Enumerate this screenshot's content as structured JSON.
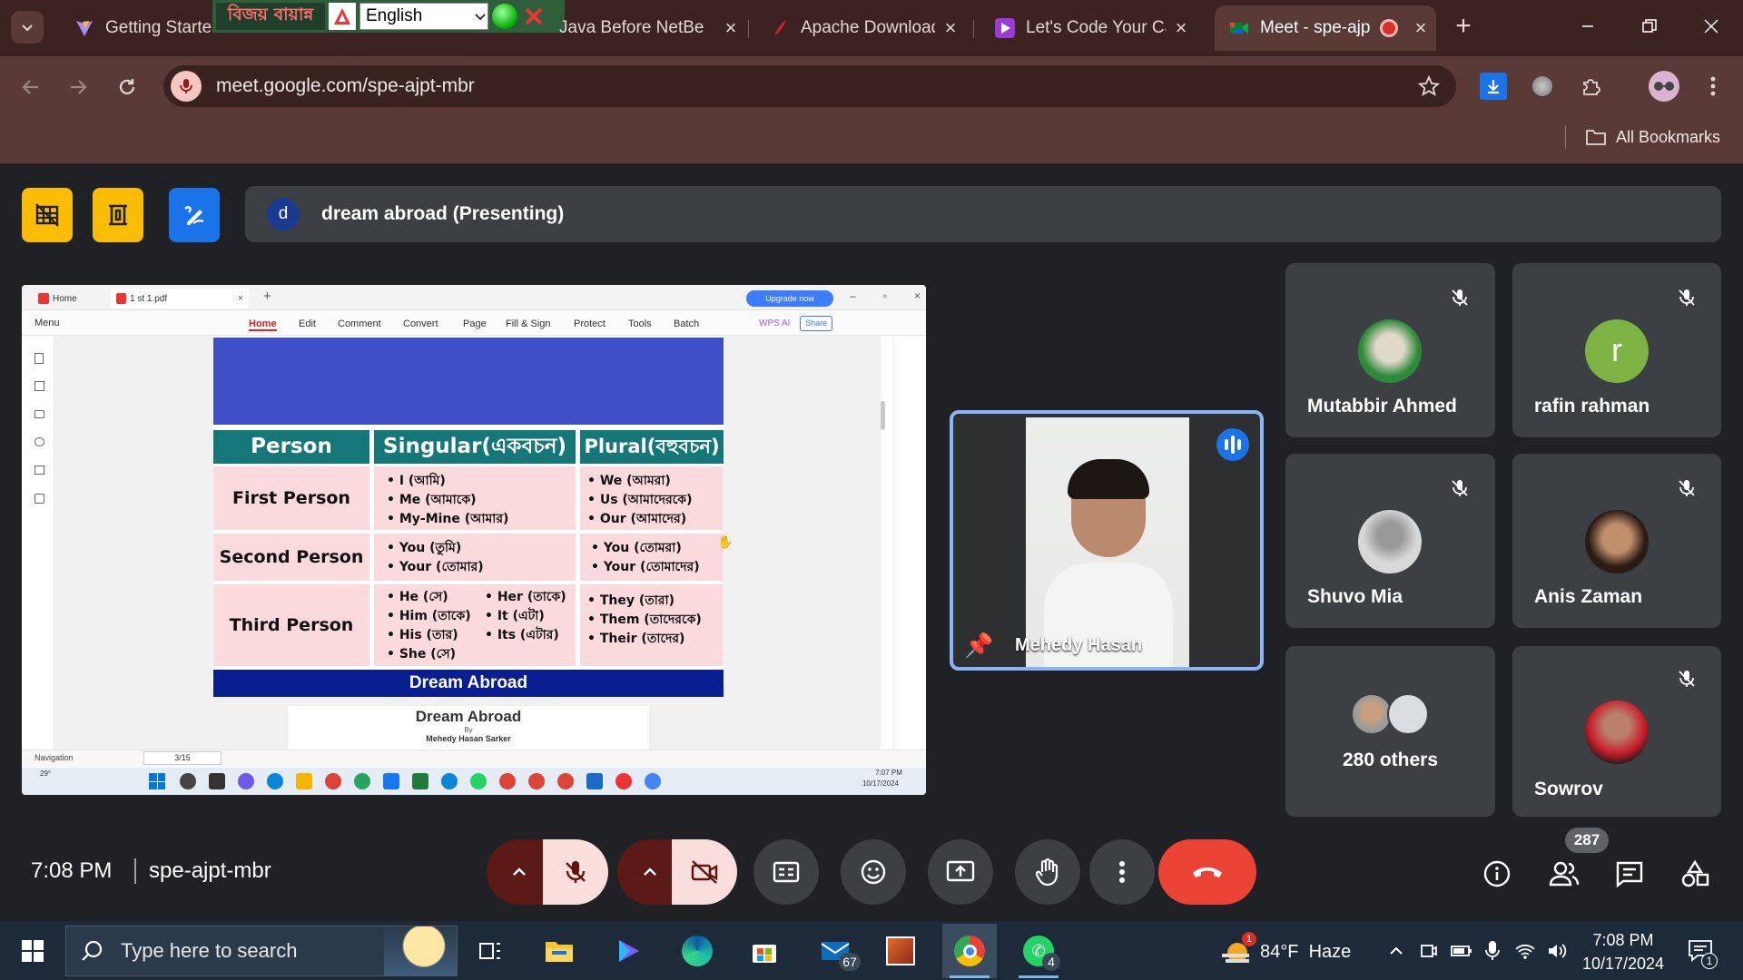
{
  "browser": {
    "tabs": [
      {
        "title": "Getting Started",
        "close": "×"
      },
      {
        "title": "Java Before NetBe",
        "close": "×"
      },
      {
        "title": "Apache Download",
        "close": "×"
      },
      {
        "title": "Let's Code Your Ca",
        "close": "×"
      },
      {
        "title": "Meet - spe-ajp",
        "close": "×"
      }
    ],
    "new_tab": "+",
    "overlay": {
      "bangla_label": "বিজয় বায়ান্ন",
      "language": "English"
    },
    "url": "meet.google.com/spe-ajpt-mbr",
    "all_bookmarks": "All Bookmarks",
    "colors": {
      "frame": "#3c2322",
      "toolbar": "#5a3a37"
    }
  },
  "meet": {
    "presenter_initial": "d",
    "presenting_label": "dream abroad (Presenting)",
    "meeting_time": "7:08 PM",
    "meeting_code": "spe-ajpt-mbr",
    "participant_count": "287",
    "speaker": {
      "name": "Mehedy Hasan"
    },
    "participants": [
      {
        "name": "Mutabbir Ahmed",
        "initial": ""
      },
      {
        "name": "rafin rahman",
        "initial": "r"
      },
      {
        "name": "Shuvo Mia",
        "initial": ""
      },
      {
        "name": "Anis Zaman",
        "initial": ""
      },
      {
        "name": "280 others",
        "initial": ""
      },
      {
        "name": "Sowrov",
        "initial": ""
      }
    ],
    "colors": {
      "end_call": "#ea4335",
      "mic_off": "#f9dedc",
      "tile": "#3c4043"
    }
  },
  "presentation": {
    "app": {
      "home_tab": "Home",
      "file_tab": "1 st 1.pdf",
      "upgrade": "Upgrade now",
      "menu": "Menu",
      "ribbon": [
        "Home",
        "Edit",
        "Comment",
        "Convert",
        "Page",
        "Fill & Sign",
        "Protect",
        "Tools",
        "Batch"
      ],
      "wps_ai": "WPS AI",
      "share": "Share",
      "navigation": "Navigation",
      "page": "3/15",
      "clock_time": "7:07 PM",
      "clock_date": "10/17/2024",
      "weather_temp": "29°"
    },
    "table": {
      "headers": [
        "Person",
        "Singular(একবচন)",
        "Plural(বহুবচন)"
      ],
      "rows": [
        {
          "person": "First Person",
          "singular": [
            "I (আমি)",
            "Me (আমাকে)",
            "My-Mine (আমার)"
          ],
          "plural": [
            "We (আমরা)",
            "Us (আমাদেরকে)",
            "Our (আমাদের)"
          ]
        },
        {
          "person": "Second Person",
          "singular": [
            "You (তুমি)",
            "Your (তোমার)"
          ],
          "plural": [
            "You (তোমরা)",
            "Your (তোমাদের)"
          ]
        },
        {
          "person": "Third Person",
          "singular": [
            "He (সে)",
            "Him (তাকে)",
            "His (তার)",
            "She (সে)"
          ],
          "singular2": [
            "Her (তাকে)",
            "It (এটা)",
            "Its (এটার)"
          ],
          "plural": [
            "They (তারা)",
            "Them (তাদেরকে)",
            "Their (তাদের)"
          ]
        }
      ],
      "footer": "Dream Abroad"
    },
    "next_page": {
      "title": "Dream Abroad",
      "by": "By",
      "author": "Mehedy Hasan Sarker"
    }
  },
  "taskbar": {
    "search_placeholder": "Type here to search",
    "weather": "84°F  Haze",
    "weather_badge": "1",
    "time": "7:08 PM",
    "date": "10/17/2024",
    "mail_badge": "67",
    "whatsapp_badge": "4",
    "notif_badge": "1"
  }
}
